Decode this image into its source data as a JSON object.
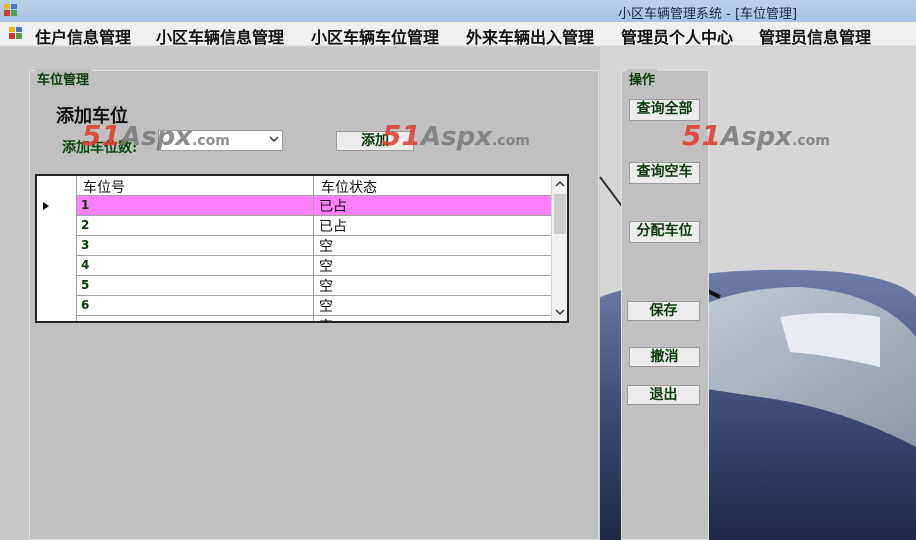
{
  "window": {
    "title": "小区车辆管理系统 - [车位管理]"
  },
  "menu": {
    "items": [
      "住户信息管理",
      "小区车辆信息管理",
      "小区车辆车位管理",
      "外来车辆出入管理",
      "管理员个人中心",
      "管理员信息管理"
    ]
  },
  "parking_group": {
    "title": "车位管理",
    "heading": "添加车位",
    "count_label": "添加车位数:",
    "add_button": "添加"
  },
  "grid": {
    "columns": [
      "车位号",
      "车位状态"
    ],
    "rows": [
      {
        "id": "1",
        "status": "已占"
      },
      {
        "id": "2",
        "status": "已占"
      },
      {
        "id": "3",
        "status": "空"
      },
      {
        "id": "4",
        "status": "空"
      },
      {
        "id": "5",
        "status": "空"
      },
      {
        "id": "6",
        "status": "空"
      },
      {
        "id": "",
        "status": "空"
      }
    ],
    "selected_row": 0
  },
  "actions_group": {
    "title": "操作",
    "buttons": {
      "query_all": "查询全部",
      "query_empty": "查询空车",
      "assign": "分配车位",
      "save": "保存",
      "cancel": "撤消",
      "exit": "退出"
    }
  },
  "watermark": {
    "num": "51",
    "word": "Aspx",
    "domain": ".com"
  },
  "colors": {
    "selected_row": "#ff80ff",
    "group_bg": "#c0c0c0",
    "label_green": "#0a4a0a"
  }
}
